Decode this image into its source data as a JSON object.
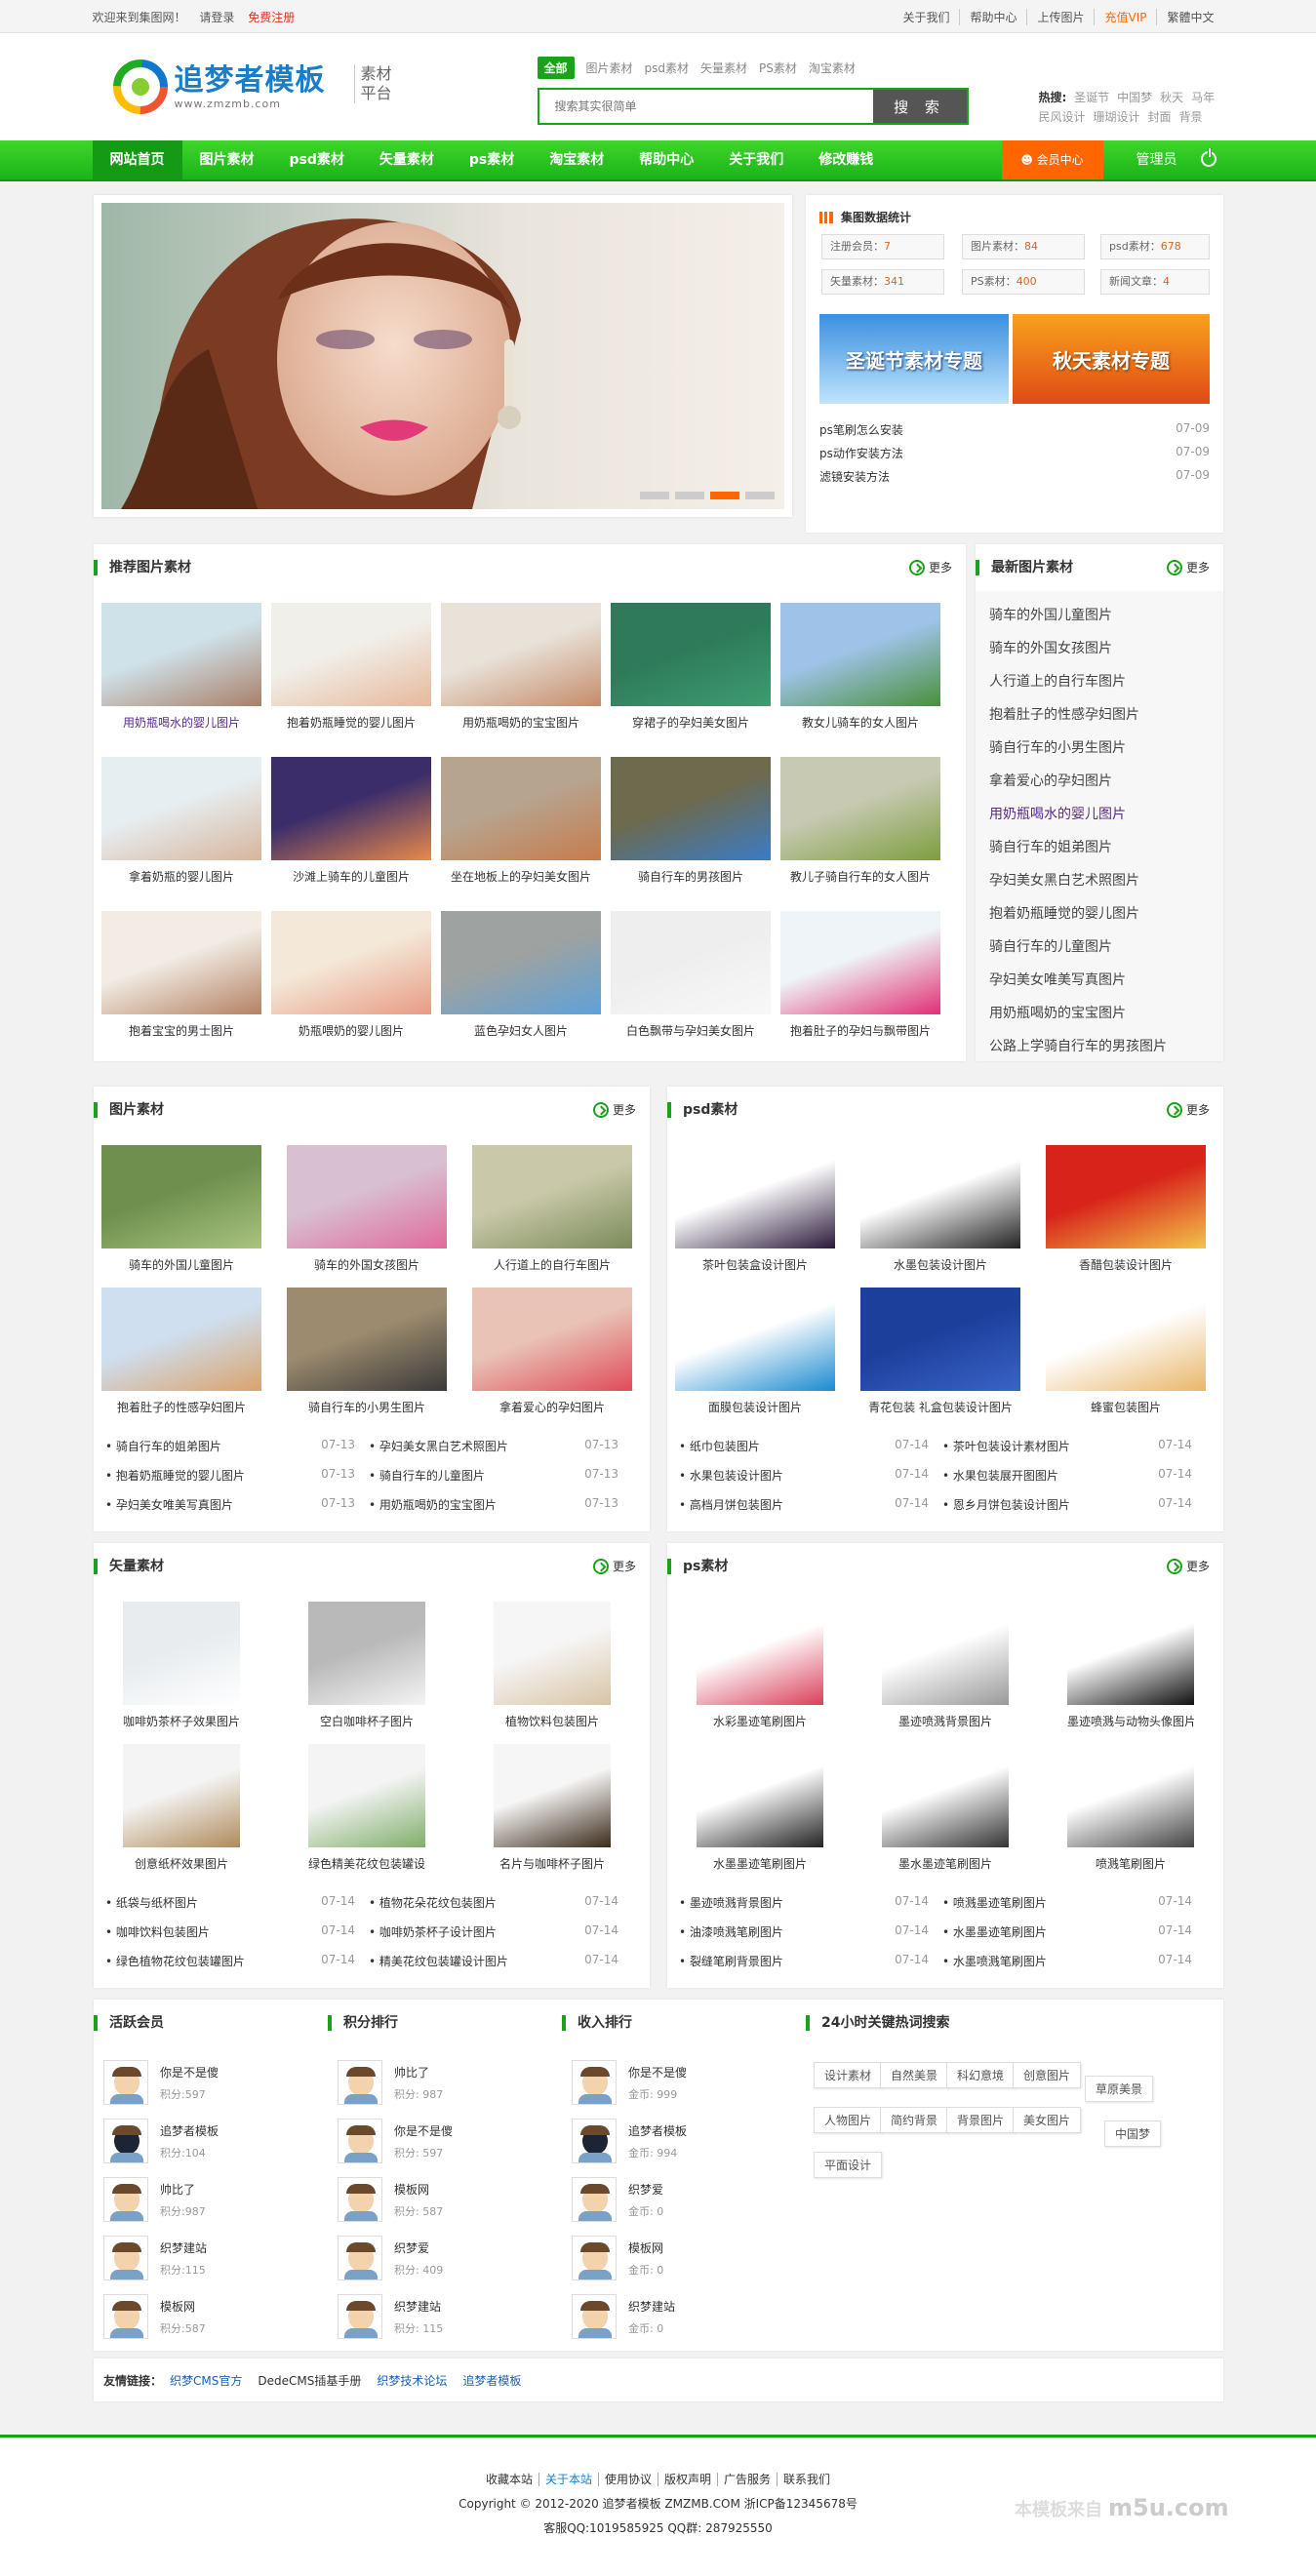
{
  "topbar": {
    "welcome": "欢迎来到集图网！",
    "login": "请登录",
    "register": "免费注册",
    "links": [
      "关于我们",
      "帮助中心",
      "上传图片",
      "充值VIP",
      "繁體中文"
    ]
  },
  "logo": {
    "name": "追梦者模板",
    "url": "www.zmzmb.com",
    "sub": "素材平台"
  },
  "search": {
    "tabs": [
      "全部",
      "图片素材",
      "psd素材",
      "矢量素材",
      "PS素材",
      "淘宝素材"
    ],
    "placeholder": "搜索其实很简单",
    "button": "搜 索"
  },
  "hot": {
    "label": "热搜:",
    "words": [
      "圣诞节",
      "中国梦",
      "秋天",
      "马年",
      "民风设计",
      "珊瑚设计",
      "封面",
      "背景"
    ]
  },
  "nav": {
    "items": [
      "网站首页",
      "图片素材",
      "psd素材",
      "矢量素材",
      "ps素材",
      "淘宝素材",
      "帮助中心",
      "关于我们",
      "修改赚钱"
    ],
    "member": "会员中心",
    "admin": "管理员"
  },
  "stats": {
    "title": "集图数据统计",
    "items": [
      {
        "k": "注册会员：",
        "v": "7"
      },
      {
        "k": "图片素材：",
        "v": "84"
      },
      {
        "k": "psd素材：",
        "v": "678"
      },
      {
        "k": "矢量素材：",
        "v": "341"
      },
      {
        "k": "PS素材：",
        "v": "400"
      },
      {
        "k": "新闻文章：",
        "v": "4"
      }
    ],
    "banners": [
      "圣诞节素材专题",
      "秋天素材专题"
    ],
    "news": [
      {
        "t": "ps笔刷怎么安装",
        "d": "07-09"
      },
      {
        "t": "ps动作安装方法",
        "d": "07-09"
      },
      {
        "t": "滤镜安装方法",
        "d": "07-09"
      }
    ]
  },
  "recommend": {
    "title": "推荐图片素材",
    "more": "更多",
    "items": [
      "用奶瓶喝水的婴儿图片",
      "抱着奶瓶睡觉的婴儿图片",
      "用奶瓶喝奶的宝宝图片",
      "穿裙子的孕妇美女图片",
      "教女儿骑车的女人图片",
      "拿着奶瓶的婴儿图片",
      "沙滩上骑车的儿童图片",
      "坐在地板上的孕妇美女图片",
      "骑自行车的男孩图片",
      "教儿子骑自行车的女人图片",
      "抱着宝宝的男士图片",
      "奶瓶喂奶的婴儿图片",
      "蓝色孕妇女人图片",
      "白色飘带与孕妇美女图片",
      "抱着肚子的孕妇与飘带图片"
    ]
  },
  "latest": {
    "title": "最新图片素材",
    "more": "更多",
    "items": [
      "骑车的外国儿童图片",
      "骑车的外国女孩图片",
      "人行道上的自行车图片",
      "抱着肚子的性感孕妇图片",
      "骑自行车的小男生图片",
      "拿着爱心的孕妇图片",
      "用奶瓶喝水的婴儿图片",
      "骑自行车的姐弟图片",
      "孕妇美女黑白艺术照图片",
      "抱着奶瓶睡觉的婴儿图片",
      "骑自行车的儿童图片",
      "孕妇美女唯美写真图片",
      "用奶瓶喝奶的宝宝图片",
      "公路上学骑自行车的男孩图片"
    ]
  },
  "pic": {
    "title": "图片素材",
    "more": "更多",
    "items": [
      "骑车的外国儿童图片",
      "骑车的外国女孩图片",
      "人行道上的自行车图片",
      "抱着肚子的性感孕妇图片",
      "骑自行车的小男生图片",
      "拿着爱心的孕妇图片"
    ],
    "list": [
      {
        "t": "骑自行车的姐弟图片",
        "d": "07-13"
      },
      {
        "t": "孕妇美女黑白艺术照图片",
        "d": "07-13"
      },
      {
        "t": "抱着奶瓶睡觉的婴儿图片",
        "d": "07-13"
      },
      {
        "t": "骑自行车的儿童图片",
        "d": "07-13"
      },
      {
        "t": "孕妇美女唯美写真图片",
        "d": "07-13"
      },
      {
        "t": "用奶瓶喝奶的宝宝图片",
        "d": "07-13"
      }
    ]
  },
  "psd": {
    "title": "psd素材",
    "more": "更多",
    "items": [
      "茶叶包装盒设计图片",
      "水墨包装设计图片",
      "香醋包装设计图片",
      "面膜包装设计图片",
      "青花包装 礼盒包装设计图片",
      "蜂蜜包装图片"
    ],
    "list": [
      {
        "t": "纸巾包装图片",
        "d": "07-14"
      },
      {
        "t": "茶叶包装设计素材图片",
        "d": "07-14"
      },
      {
        "t": "水果包装设计图片",
        "d": "07-14"
      },
      {
        "t": "水果包装展开图图片",
        "d": "07-14"
      },
      {
        "t": "高档月饼包装图片",
        "d": "07-14"
      },
      {
        "t": "恩乡月饼包装设计图片",
        "d": "07-14"
      }
    ]
  },
  "vector": {
    "title": "矢量素材",
    "more": "更多",
    "items": [
      "咖啡奶茶杯子效果图片",
      "空白咖啡杯子图片",
      "植物饮料包装图片",
      "创意纸杯效果图片",
      "绿色精美花纹包装罐设计图片",
      "名片与咖啡杯子图片"
    ],
    "list": [
      {
        "t": "纸袋与纸杯图片",
        "d": "07-14"
      },
      {
        "t": "植物花朵花纹包装图片",
        "d": "07-14"
      },
      {
        "t": "咖啡饮料包装图片",
        "d": "07-14"
      },
      {
        "t": "咖啡奶茶杯子设计图片",
        "d": "07-14"
      },
      {
        "t": "绿色植物花纹包装罐图片",
        "d": "07-14"
      },
      {
        "t": "精美花纹包装罐设计图片",
        "d": "07-14"
      }
    ]
  },
  "ps": {
    "title": "ps素材",
    "more": "更多",
    "items": [
      "水彩墨迹笔刷图片",
      "墨迹喷溅背景图片",
      "墨迹喷溅与动物头像图片",
      "水墨墨迹笔刷图片",
      "墨水墨迹笔刷图片",
      "喷溅笔刷图片"
    ],
    "list": [
      {
        "t": "墨迹喷溅背景图片",
        "d": "07-14"
      },
      {
        "t": "喷溅墨迹笔刷图片",
        "d": "07-14"
      },
      {
        "t": "油漆喷溅笔刷图片",
        "d": "07-14"
      },
      {
        "t": "水墨墨迹笔刷图片",
        "d": "07-14"
      },
      {
        "t": "裂缝笔刷背景图片",
        "d": "07-14"
      },
      {
        "t": "水墨喷溅笔刷图片",
        "d": "07-14"
      }
    ]
  },
  "active": {
    "title": "活跃会员",
    "items": [
      {
        "n": "你是不是傻",
        "s": "积分:597"
      },
      {
        "n": "追梦者模板",
        "s": "积分:104"
      },
      {
        "n": "帅比了",
        "s": "积分:987"
      },
      {
        "n": "织梦建站",
        "s": "积分:115"
      },
      {
        "n": "模板网",
        "s": "积分:587"
      }
    ]
  },
  "points": {
    "title": "积分排行",
    "items": [
      {
        "n": "帅比了",
        "s": "积分: 987"
      },
      {
        "n": "你是不是傻",
        "s": "积分: 597"
      },
      {
        "n": "模板网",
        "s": "积分: 587"
      },
      {
        "n": "织梦爱",
        "s": "积分: 409"
      },
      {
        "n": "织梦建站",
        "s": "积分: 115"
      }
    ]
  },
  "income": {
    "title": "收入排行",
    "items": [
      {
        "n": "你是不是傻",
        "s": "金币: 999"
      },
      {
        "n": "追梦者模板",
        "s": "金币: 994"
      },
      {
        "n": "织梦爱",
        "s": "金币: 0"
      },
      {
        "n": "模板网",
        "s": "金币: 0"
      },
      {
        "n": "织梦建站",
        "s": "金币: 0"
      }
    ]
  },
  "hotkw": {
    "title": "24小时关键热词搜索",
    "tags": [
      "设计素材",
      "自然美景",
      "科幻意境",
      "创意图片",
      "草原美景",
      "人物图片",
      "简约背景",
      "背景图片",
      "美女图片",
      "中国梦",
      "平面设计"
    ]
  },
  "friends": {
    "label": "友情链接：",
    "items": [
      "织梦CMS官方",
      "DedeCMS插基手册",
      "织梦技术论坛",
      "追梦者模板"
    ]
  },
  "footer": {
    "links": [
      "收藏本站",
      "关于本站",
      "使用协议",
      "版权声明",
      "广告服务",
      "联系我们"
    ],
    "copyright": "Copyright © 2012-2020 追梦者模板 ZMZMB.COM 浙ICP备12345678号",
    "qq": "客服QQ:1019585925 QQ群: 287925550",
    "watermark": "本模板来自",
    "watermark2": "m5u.com"
  },
  "colors": {
    "green": "#1aa21a",
    "orange": "#ff6600",
    "blue": "#1a7dc7"
  }
}
